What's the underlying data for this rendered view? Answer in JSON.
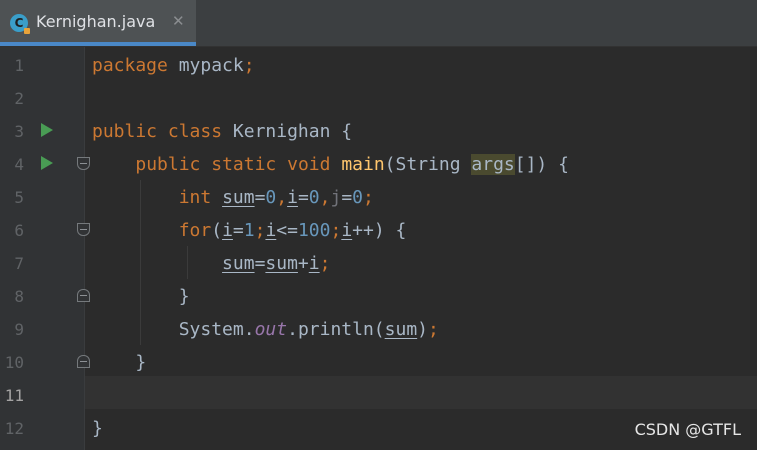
{
  "tab": {
    "filename": "Kernighan.java",
    "icon_letter": "C",
    "close_glyph": "✕"
  },
  "line_numbers": [
    "1",
    "2",
    "3",
    "4",
    "5",
    "6",
    "7",
    "8",
    "9",
    "10",
    "11",
    "12"
  ],
  "code": {
    "l1": {
      "kw": "package",
      "name": "mypack",
      "semi": ";"
    },
    "l3": {
      "kw1": "public",
      "kw2": "class",
      "name": "Kernighan",
      "brace": "{"
    },
    "l4": {
      "kw1": "public",
      "kw2": "static",
      "kw3": "void",
      "method": "main",
      "open": "(",
      "type": "String",
      "param": "args",
      "close": "[]) {"
    },
    "l5": {
      "kw": "int",
      "v1": "sum",
      "eq1": "=",
      "n1": "0",
      "c1": ",",
      "v2": "i",
      "eq2": "=",
      "n2": "0",
      "c2": ",",
      "v3": "j",
      "eq3": "=",
      "n3": "0",
      "semi": ";"
    },
    "l6": {
      "kw": "for",
      "open": "(",
      "v1": "i",
      "eq": "=",
      "n1": "1",
      "s1": ";",
      "v2": "i",
      "op": "<=",
      "n2": "100",
      "s2": ";",
      "v3": "i",
      "inc": "++",
      "close": ") {"
    },
    "l7": {
      "v1": "sum",
      "eq": "=",
      "v2": "sum",
      "plus": "+",
      "v3": "i",
      "semi": ";"
    },
    "l8": {
      "brace": "}"
    },
    "l9": {
      "cls": "System",
      "dot1": ".",
      "field": "out",
      "dot2": ".",
      "method": "println",
      "open": "(",
      "arg": "sum",
      "close": ")",
      "semi": ";"
    },
    "l10": {
      "brace": "}"
    },
    "l12": {
      "brace": "}"
    }
  },
  "watermark": "CSDN @GTFL",
  "colors": {
    "keyword": "#cc7832",
    "number": "#6897bb",
    "method": "#ffc66d",
    "field": "#9876aa",
    "text": "#a9b7c6",
    "run": "#499c54",
    "tab_accent": "#4a88c7"
  }
}
